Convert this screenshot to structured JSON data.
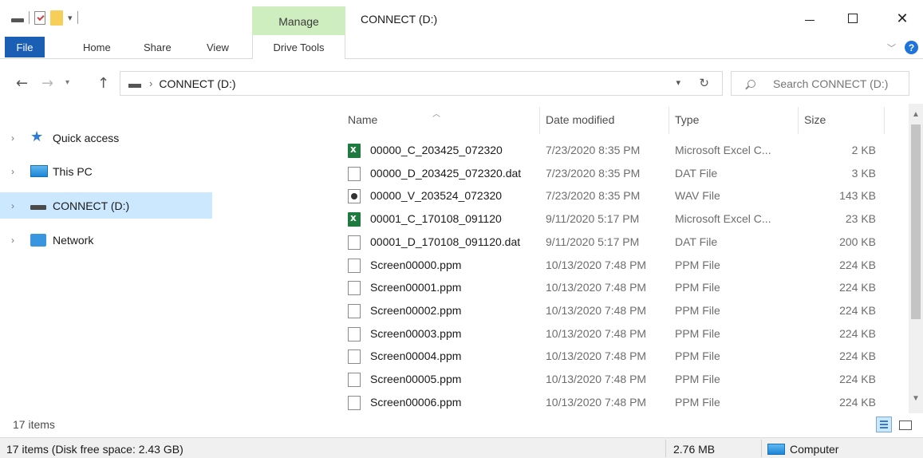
{
  "window": {
    "title": "CONNECT (D:)",
    "manage_label": "Manage",
    "controls": {
      "minimize": "minimize",
      "maximize": "maximize",
      "close": "✕"
    }
  },
  "ribbon": {
    "file_label": "File",
    "tabs": [
      {
        "label": "Home"
      },
      {
        "label": "Share"
      },
      {
        "label": "View"
      }
    ],
    "drive_tools_label": "Drive Tools",
    "help_label": "?"
  },
  "address": {
    "path": "CONNECT (D:)",
    "search_placeholder": "Search CONNECT (D:)"
  },
  "navpane": {
    "items": [
      {
        "label": "Quick access",
        "icon": "star-icon"
      },
      {
        "label": "This PC",
        "icon": "computer-icon"
      },
      {
        "label": "CONNECT (D:)",
        "icon": "drive-icon",
        "selected": true
      },
      {
        "label": "Network",
        "icon": "network-icon"
      }
    ]
  },
  "columns": {
    "name": "Name",
    "date": "Date modified",
    "type": "Type",
    "size": "Size"
  },
  "files": [
    {
      "name": "00000_C_203425_072320",
      "date": "7/23/2020 8:35 PM",
      "type": "Microsoft Excel C...",
      "size": "2 KB",
      "icon": "excel"
    },
    {
      "name": "00000_D_203425_072320.dat",
      "date": "7/23/2020 8:35 PM",
      "type": "DAT File",
      "size": "3 KB",
      "icon": "doc"
    },
    {
      "name": "00000_V_203524_072320",
      "date": "7/23/2020 8:35 PM",
      "type": "WAV File",
      "size": "143 KB",
      "icon": "wav"
    },
    {
      "name": "00001_C_170108_091120",
      "date": "9/11/2020 5:17 PM",
      "type": "Microsoft Excel C...",
      "size": "23 KB",
      "icon": "excel"
    },
    {
      "name": "00001_D_170108_091120.dat",
      "date": "9/11/2020 5:17 PM",
      "type": "DAT File",
      "size": "200 KB",
      "icon": "doc"
    },
    {
      "name": "Screen00000.ppm",
      "date": "10/13/2020 7:48 PM",
      "type": "PPM File",
      "size": "224 KB",
      "icon": "doc"
    },
    {
      "name": "Screen00001.ppm",
      "date": "10/13/2020 7:48 PM",
      "type": "PPM File",
      "size": "224 KB",
      "icon": "doc"
    },
    {
      "name": "Screen00002.ppm",
      "date": "10/13/2020 7:48 PM",
      "type": "PPM File",
      "size": "224 KB",
      "icon": "doc"
    },
    {
      "name": "Screen00003.ppm",
      "date": "10/13/2020 7:48 PM",
      "type": "PPM File",
      "size": "224 KB",
      "icon": "doc"
    },
    {
      "name": "Screen00004.ppm",
      "date": "10/13/2020 7:48 PM",
      "type": "PPM File",
      "size": "224 KB",
      "icon": "doc"
    },
    {
      "name": "Screen00005.ppm",
      "date": "10/13/2020 7:48 PM",
      "type": "PPM File",
      "size": "224 KB",
      "icon": "doc"
    },
    {
      "name": "Screen00006.ppm",
      "date": "10/13/2020 7:48 PM",
      "type": "PPM File",
      "size": "224 KB",
      "icon": "doc"
    }
  ],
  "item_count": "17 items",
  "status": {
    "text": "17 items (Disk free space: 2.43 GB)",
    "size": "2.76 MB",
    "location": "Computer"
  }
}
